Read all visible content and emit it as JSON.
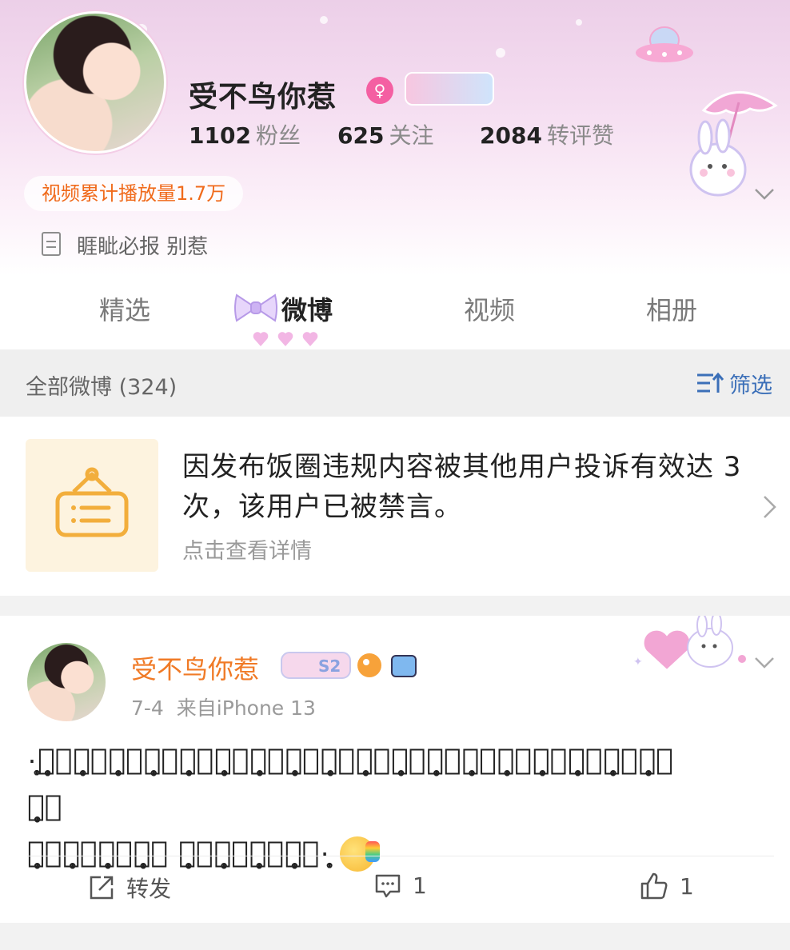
{
  "profile": {
    "name": "受不鸟你惹",
    "gender_icon": "female-symbol",
    "stats": [
      {
        "value": "1102",
        "label": "粉丝"
      },
      {
        "value": "625",
        "label": "关注"
      },
      {
        "value": "2084",
        "label": "转评赞"
      }
    ],
    "video_plays": "视频累计播放量1.7万",
    "bio": "睚眦必报 别惹"
  },
  "tabs": [
    {
      "label": "精选",
      "active": false
    },
    {
      "label": "微博",
      "active": true
    },
    {
      "label": "视频",
      "active": false
    },
    {
      "label": "相册",
      "active": false
    }
  ],
  "filter_bar": {
    "all_label": "全部微博 (324)",
    "filter_label": "筛选"
  },
  "notice": {
    "text": "因发布饭圈违规内容被其他用户投诉有效达 3次，该用户已被禁言。",
    "link": "点击查看详情"
  },
  "post": {
    "author": "受不鸟你惹",
    "date": "7-4",
    "source": "来自iPhone 13",
    "content_line1": "·̩̩̥͙滴̩̩̥͙滴̩̩̥͙滴̩̩̥͙，̩̩̥͙怎̩̩̥͙么̩̩̥͙卡̩̩̥͙了̩̩̥͙我̩̩̥͙半̩̩̥͙天̩̩̥͙没̩̩̥͙反̩̩̥͙应̩̩̥͙啊̩̩̥͙这̩̩̥͙都̩̩̥͙几̩̩̥͙天̩̩̥͙",
    "content_line2": "了̩̩̥͙？̩̩̥͙？̩̩̥͙？̩̩̥͙ 没̩̩̥͙吃̩̩̥͙饭̩̩̥͙啊̩̩̥͙·̩̩̥͙",
    "actions": {
      "repost": "转发",
      "comments": "1",
      "likes": "1"
    }
  },
  "colors": {
    "accent_orange": "#f07a26",
    "link_blue": "#3b6fb8",
    "gender_pink": "#f45fa2"
  }
}
